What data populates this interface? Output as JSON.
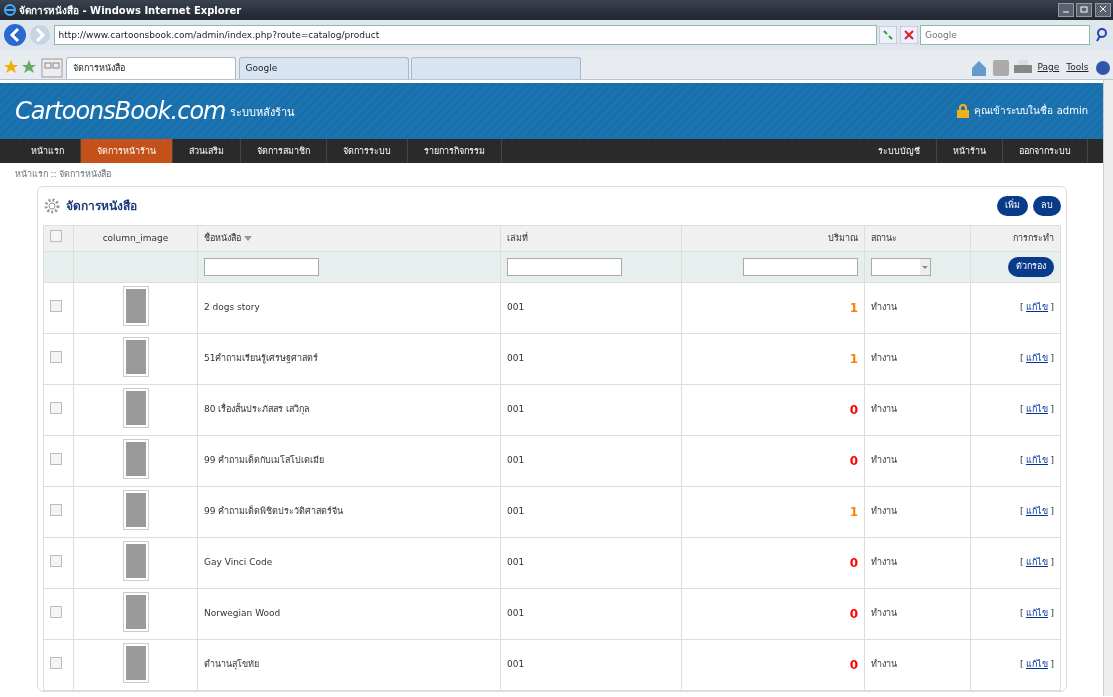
{
  "window": {
    "title": "จัดการหนังสือ - Windows Internet Explorer"
  },
  "browser": {
    "address": "http://www.cartoonsbook.com/admin/index.php?route=catalog/product",
    "search_placeholder": "Google",
    "tabs": [
      {
        "label": "จัดการหนังสือ",
        "selected": true
      },
      {
        "label": "Google",
        "selected": false
      }
    ],
    "tools": [
      "Page",
      "Tools"
    ]
  },
  "header": {
    "logo": "CartoonsBook.com",
    "subtitle": "ระบบหลังร้าน",
    "login": "คุณเข้าระบบในชื่อ admin"
  },
  "nav": {
    "left": [
      {
        "label": "หน้าแรก",
        "selected": false
      },
      {
        "label": "จัดการหน้าร้าน",
        "selected": true
      },
      {
        "label": "ส่วนเสริม",
        "selected": false
      },
      {
        "label": "จัดการสมาชิก",
        "selected": false
      },
      {
        "label": "จัดการระบบ",
        "selected": false
      },
      {
        "label": "รายการกิจกรรม",
        "selected": false
      }
    ],
    "right": [
      {
        "label": "ระบบบัญชี",
        "selected": false
      },
      {
        "label": "หน้าร้าน",
        "selected": false
      },
      {
        "label": "ออกจากระบบ",
        "selected": false
      }
    ]
  },
  "breadcrumb": [
    "หน้าแรก",
    "::",
    "จัดการหนังสือ"
  ],
  "panel": {
    "title": "จัดการหนังสือ",
    "buttons": [
      "เพิ่ม",
      "ลบ"
    ]
  },
  "table": {
    "columns": [
      "column_image",
      "ชื่อหนังสือ",
      "เล่มที่",
      "ปริมาณ",
      "สถานะ",
      "การกระทำ"
    ],
    "filter_button": "ตัวกรอง",
    "select_all_checked": false,
    "edit_brackets": [
      "[",
      "]"
    ],
    "rows": [
      {
        "checked": false,
        "name": "2 dogs story",
        "volume": "001",
        "quantity": "1",
        "color": "#ff8000",
        "status": "ทำงาน",
        "action": "แก้ไข"
      },
      {
        "checked": false,
        "name": "51คำถามเรียนรู้เศรษฐศาสตร์",
        "volume": "001",
        "quantity": "1",
        "color": "#ff8000",
        "status": "ทำงาน",
        "action": "แก้ไข"
      },
      {
        "checked": false,
        "name": "80 เรื่องสั้นประภัสสร เสวิกุล",
        "volume": "001",
        "quantity": "0",
        "color": "#ff0000",
        "status": "ทำงาน",
        "action": "แก้ไข"
      },
      {
        "checked": false,
        "name": "99 คำถามเด็ดกับเมโสโปเตเมีย",
        "volume": "001",
        "quantity": "0",
        "color": "#ff0000",
        "status": "ทำงาน",
        "action": "แก้ไข"
      },
      {
        "checked": false,
        "name": "99 คำถามเด็ดพิชิตประวัติศาสตร์จีน",
        "volume": "001",
        "quantity": "1",
        "color": "#ff8000",
        "status": "ทำงาน",
        "action": "แก้ไข"
      },
      {
        "checked": false,
        "name": "Gay Vinci Code",
        "volume": "001",
        "quantity": "0",
        "color": "#ff0000",
        "status": "ทำงาน",
        "action": "แก้ไข"
      },
      {
        "checked": false,
        "name": "Norwegian Wood",
        "volume": "001",
        "quantity": "0",
        "color": "#ff0000",
        "status": "ทำงาน",
        "action": "แก้ไข"
      },
      {
        "checked": false,
        "name": "ตำนานสุโขทัย",
        "volume": "001",
        "quantity": "0",
        "color": "#ff0000",
        "status": "ทำงาน",
        "action": "แก้ไข"
      }
    ]
  }
}
